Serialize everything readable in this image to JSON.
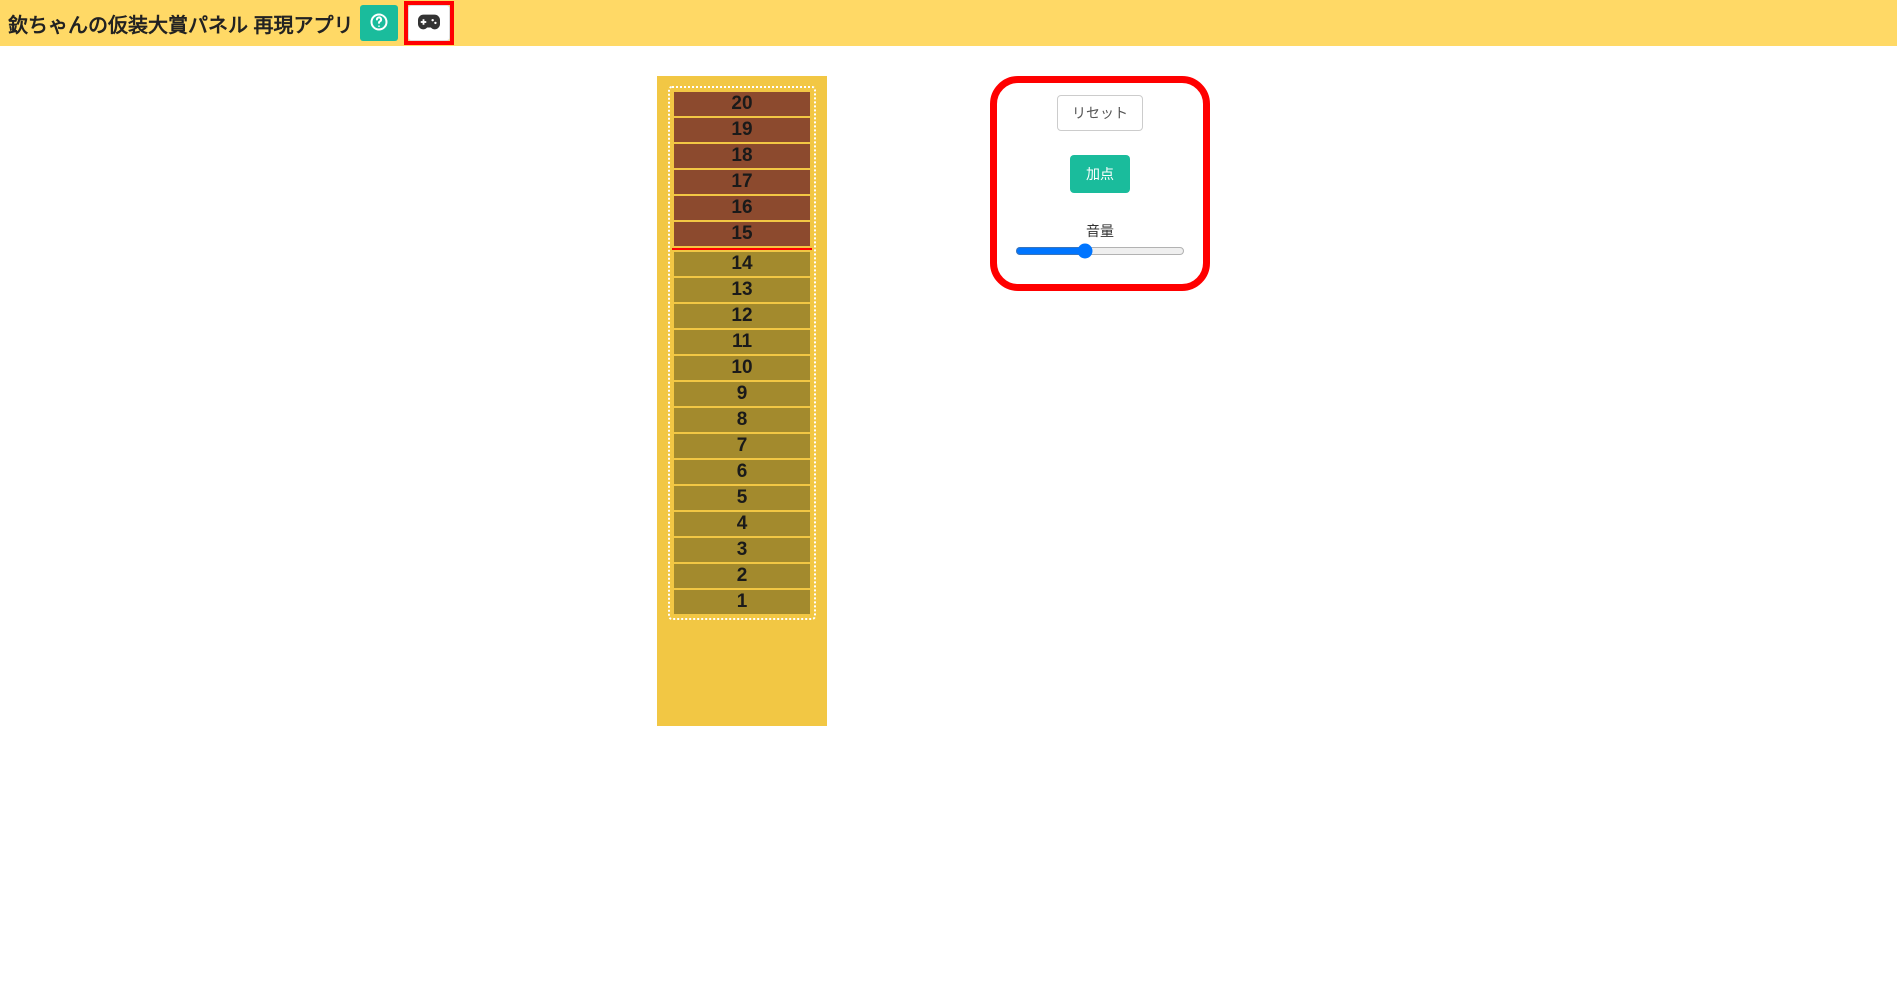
{
  "header": {
    "title": "欽ちゃんの仮装大賞パネル 再現アプリ"
  },
  "panel": {
    "max": 20,
    "current": 14,
    "threshold": 15,
    "rows": [
      1,
      2,
      3,
      4,
      5,
      6,
      7,
      8,
      9,
      10,
      11,
      12,
      13,
      14,
      15,
      16,
      17,
      18,
      19,
      20
    ]
  },
  "controls": {
    "reset_label": "リセット",
    "score_label": "加点",
    "volume_label": "音量",
    "volume_value": 40,
    "volume_min": 0,
    "volume_max": 100
  },
  "colors": {
    "header_bg": "#ffd966",
    "accent": "#1abc9c",
    "highlight": "#ff0000",
    "panel_bg": "#f2c744",
    "lit": "#a38a2d",
    "unlit": "#8c4a2e"
  }
}
